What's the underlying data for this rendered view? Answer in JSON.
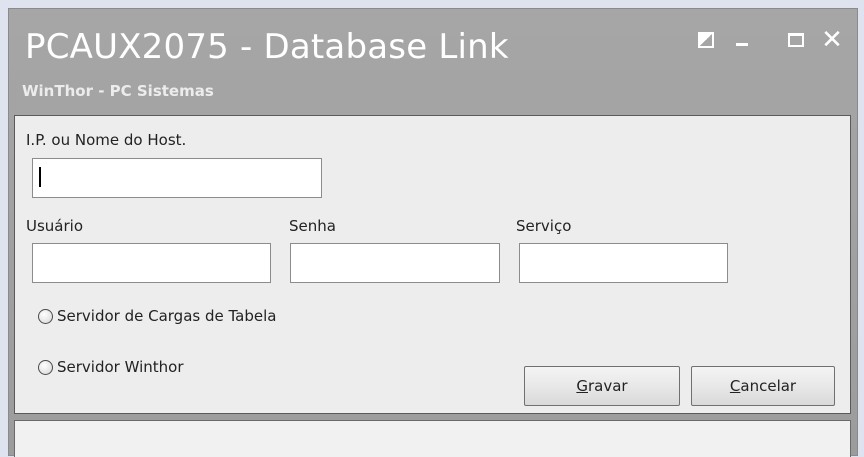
{
  "window": {
    "title": "PCAUX2075 - Database Link",
    "subtitle": "WinThor - PC Sistemas"
  },
  "form": {
    "host_label": "I.P. ou Nome do Host.",
    "host_value": "",
    "user_label": "Usuário",
    "user_value": "",
    "password_label": "Senha",
    "password_value": "",
    "service_label": "Serviço",
    "service_value": "",
    "radio_options": [
      {
        "label": "Servidor de Cargas de Tabela",
        "checked": false
      },
      {
        "label": "Servidor Winthor",
        "checked": false
      }
    ]
  },
  "buttons": {
    "save_mnemonic": "G",
    "save_rest": "ravar",
    "cancel_mnemonic": "C",
    "cancel_rest": "ancelar"
  },
  "icons": {
    "restore": "restore-icon",
    "minimize": "minimize-icon",
    "maximize": "maximize-icon",
    "close": "close-icon"
  },
  "colors": {
    "titlebar": "#a3a3a3",
    "panel": "#ededed",
    "page_background": "#dfe3ef"
  }
}
